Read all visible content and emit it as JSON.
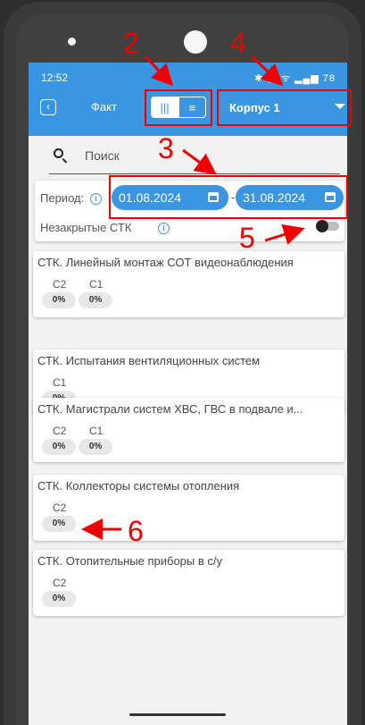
{
  "status_bar": {
    "time": "12:52",
    "icons": "✱ ▣ ᯤ ▂▄▆ 78"
  },
  "app_bar": {
    "back_icon": "chevron-left-icon",
    "title": "Факт",
    "view_toggle": {
      "grid_glyph": "|||",
      "list_glyph": "≡",
      "selected": "grid"
    },
    "building_select": "Корпус 1"
  },
  "search": {
    "placeholder": "Поиск"
  },
  "filter": {
    "period_label": "Период:",
    "date_from": "01.08.2024",
    "dash": "-",
    "date_to": "31.08.2024",
    "unclosed_label": "Незакрытые СТК",
    "unclosed_toggle": false
  },
  "cards": [
    {
      "title": "СТК. Линейный монтаж СОТ видеонаблюдения",
      "stages": [
        {
          "name": "C2",
          "pct": "0%"
        },
        {
          "name": "C1",
          "pct": "0%"
        }
      ]
    },
    {
      "title": "СТК. Испытания вентиляционных систем",
      "stages": [
        {
          "name": "C1",
          "pct": "0%"
        }
      ]
    },
    {
      "title": "СТК. Магистрали систем ХВС, ГВС в подвале и...",
      "stages": [
        {
          "name": "C2",
          "pct": "0%"
        },
        {
          "name": "C1",
          "pct": "0%"
        }
      ]
    },
    {
      "title": "СТК. Коллекторы системы отопления",
      "stages": [
        {
          "name": "C2",
          "pct": "0%"
        }
      ]
    },
    {
      "title": "СТК. Отопительные приборы в с/у",
      "stages": [
        {
          "name": "C2",
          "pct": "0%"
        }
      ]
    }
  ],
  "annotations": {
    "n2": "2",
    "n3": "3",
    "n4": "4",
    "n5": "5",
    "n6": "6",
    "color": "#e00000"
  }
}
